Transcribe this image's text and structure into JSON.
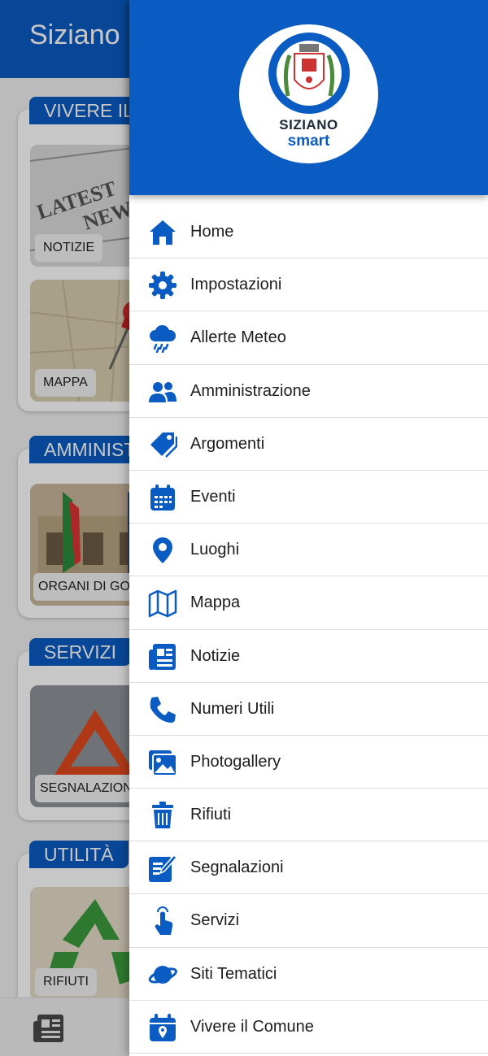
{
  "app": {
    "title": "Siziano"
  },
  "sections": {
    "vivere": "VIVERE IL",
    "amministrazione": "AMMINIST",
    "servizi": "SERVIZI",
    "utilita": "UTILITÀ"
  },
  "cards": {
    "notizie": "NOTIZIE",
    "mappa": "MAPPA",
    "organi": "ORGANI DI GOVER",
    "segnalazioni": "SEGNALAZIONI",
    "rifiuti": "RIFIUTI"
  },
  "logo": {
    "line1": "SIZIANO",
    "line2": "smart"
  },
  "menu": {
    "items": [
      {
        "label": "Home",
        "icon": "home-icon"
      },
      {
        "label": "Impostazioni",
        "icon": "gear-icon"
      },
      {
        "label": "Allerte Meteo",
        "icon": "cloud-rain-icon"
      },
      {
        "label": "Amministrazione",
        "icon": "users-icon"
      },
      {
        "label": "Argomenti",
        "icon": "tags-icon"
      },
      {
        "label": "Eventi",
        "icon": "calendar-icon"
      },
      {
        "label": "Luoghi",
        "icon": "map-pin-icon"
      },
      {
        "label": "Mappa",
        "icon": "map-icon"
      },
      {
        "label": "Notizie",
        "icon": "newspaper-icon"
      },
      {
        "label": "Numeri Utili",
        "icon": "phone-icon"
      },
      {
        "label": "Photogallery",
        "icon": "images-icon"
      },
      {
        "label": "Rifiuti",
        "icon": "trash-icon"
      },
      {
        "label": "Segnalazioni",
        "icon": "edit-icon"
      },
      {
        "label": "Servizi",
        "icon": "hand-pointer-icon"
      },
      {
        "label": "Siti Tematici",
        "icon": "planet-icon"
      },
      {
        "label": "Vivere il Comune",
        "icon": "calendar-pin-icon"
      }
    ]
  },
  "colors": {
    "primary": "#0b5cc2",
    "divider": "#dcdcdc"
  }
}
